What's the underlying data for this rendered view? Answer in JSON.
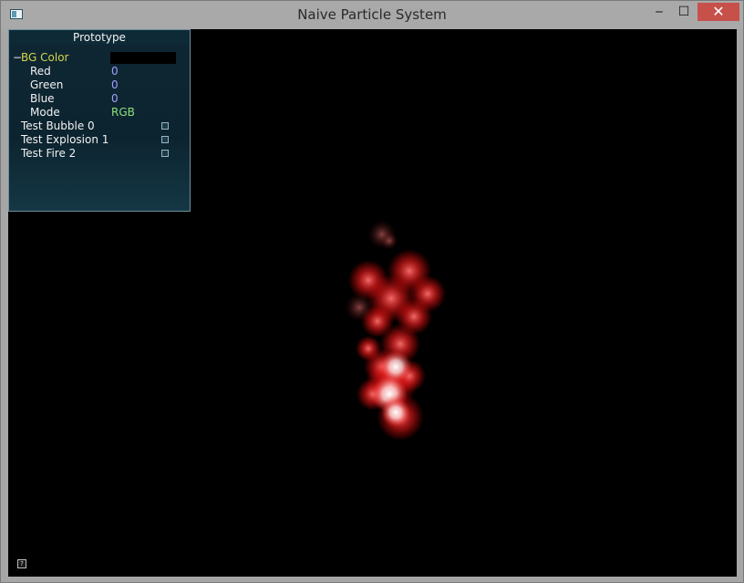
{
  "window": {
    "title": "Naive Particle System",
    "minimize_glyph": "‒",
    "maximize_glyph": "☐",
    "close_glyph": "✕"
  },
  "panel": {
    "title": "Prototype",
    "bg_color": {
      "label": "BG Color",
      "collapse_glyph": "−",
      "color": "#000000"
    },
    "fields": [
      {
        "label": "Red",
        "value": "0"
      },
      {
        "label": "Green",
        "value": "0"
      },
      {
        "label": "Blue",
        "value": "0"
      },
      {
        "label": "Mode",
        "value": "RGB"
      }
    ],
    "tests": [
      {
        "label": "Test Bubble 0",
        "checked": false
      },
      {
        "label": "Test Explosion 1",
        "checked": false
      },
      {
        "label": "Test Fire 2",
        "checked": false
      }
    ]
  },
  "help_glyph": "?",
  "colors": {
    "accent_yellow": "#d4d44a",
    "value_blue": "#a0a0ff",
    "value_green": "#8fe07a",
    "particle_red": "#ff2a2a"
  }
}
